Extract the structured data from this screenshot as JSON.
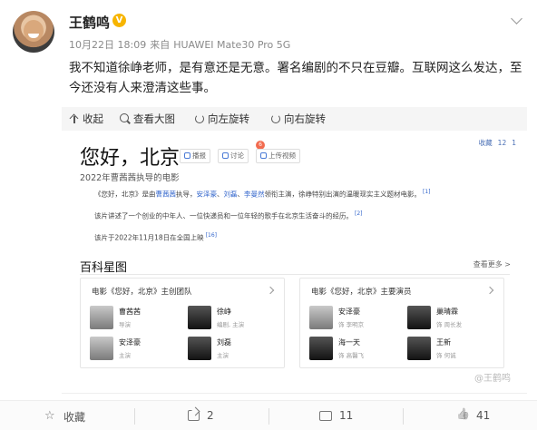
{
  "post": {
    "author": "王鹤鸣",
    "verified_badge": "V",
    "date": "10月22日 18:09",
    "source_prefix": "来自",
    "device": "HUAWEI Mate30 Pro 5G",
    "text": "我不知道徐峥老师，是有意还是无意。署名编剧的不只在豆瓣。互联网这么发达，至今还没有人来澄清这些事。"
  },
  "image_toolbar": {
    "collapse": "收起",
    "view_large": "查看大图",
    "rotate_left": "向左旋转",
    "rotate_right": "向右旋转"
  },
  "embedded": {
    "title": "您好，北京",
    "chips": [
      "播报",
      "讨论",
      "上传视频"
    ],
    "discuss_badge": "6",
    "top_right": [
      "收藏",
      "12",
      "1"
    ],
    "subtitle": "2022年曹茜茜执导的电影",
    "para1_prefix": "《您好，北京》是由",
    "para1_link1": "曹茜茜",
    "para1_mid1": "执导，",
    "para1_link2": "安泽豪",
    "para1_sep1": "、",
    "para1_link3": "刘磊",
    "para1_sep2": "、",
    "para1_link4": "李曼然",
    "para1_suffix": "领衔主演，徐峥特别出演的温暖现实主义题材电影。",
    "para1_ref": "[1]",
    "para2": "该片讲述了一个创业的中年人、一位快递员和一位年轻的歌手在北京生活奋斗的经历。",
    "para2_ref": "[2]",
    "para3": "该片于2022年11月18日在全国上映",
    "para3_ref": "[16]",
    "section_title": "百科星图",
    "see_more": "查看更多 >",
    "team_card_title": "电影《您好，北京》主创团队",
    "team": [
      {
        "name": "曹茜茜",
        "role": "导演"
      },
      {
        "name": "徐峥",
        "role": "编剧, 主演"
      },
      {
        "name": "安泽豪",
        "role": "主演"
      },
      {
        "name": "刘磊",
        "role": "主演"
      }
    ],
    "cast_card_title": "电影《您好，北京》主要演员",
    "cast": [
      {
        "name": "安泽豪",
        "role": "饰 李明京"
      },
      {
        "name": "巢晴霖",
        "role": "饰 周长发"
      },
      {
        "name": "海一天",
        "role": "饰 高醫飞"
      },
      {
        "name": "王新",
        "role": "饰 何诚"
      }
    ],
    "watermark": "@王鹤鸣"
  },
  "footer": {
    "favorite": "收藏",
    "shares": "2",
    "comments": "11",
    "likes": "41"
  }
}
